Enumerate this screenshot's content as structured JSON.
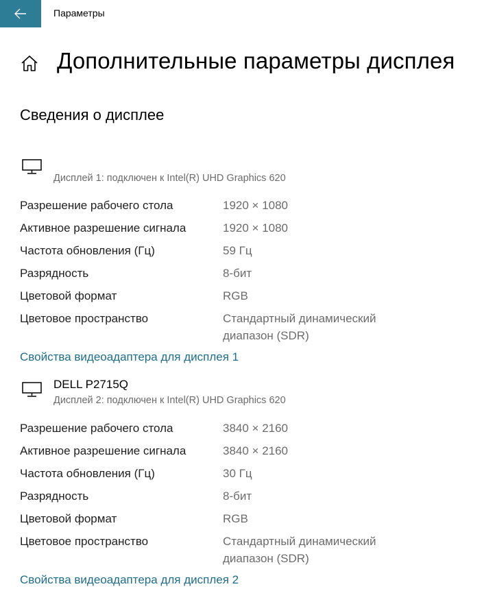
{
  "window": {
    "title": "Параметры"
  },
  "page": {
    "title": "Дополнительные параметры дисплея",
    "section_title": "Сведения о дисплее"
  },
  "colors": {
    "accent": "#2e7d96",
    "link": "#1d6d8c",
    "secondary_text": "#6b6b6b"
  },
  "icons": {
    "back": "arrow-left-icon",
    "home": "home-icon",
    "monitor": "monitor-icon"
  },
  "displays": [
    {
      "name": "",
      "subtitle": "Дисплей 1: подключен к Intel(R) UHD Graphics 620",
      "rows": [
        {
          "label": "Разрешение рабочего стола",
          "value": "1920 × 1080"
        },
        {
          "label": "Активное разрешение сигнала",
          "value": "1920 × 1080"
        },
        {
          "label": "Частота обновления (Гц)",
          "value": "59 Гц"
        },
        {
          "label": "Разрядность",
          "value": "8-бит"
        },
        {
          "label": "Цветовой формат",
          "value": "RGB"
        },
        {
          "label": "Цветовое пространство",
          "value": "Стандартный динамический диапазон (SDR)"
        }
      ],
      "adapter_link": "Свойства видеоадаптера для дисплея 1"
    },
    {
      "name": "DELL P2715Q",
      "subtitle": "Дисплей 2: подключен к Intel(R) UHD Graphics 620",
      "rows": [
        {
          "label": "Разрешение рабочего стола",
          "value": "3840 × 2160"
        },
        {
          "label": "Активное разрешение сигнала",
          "value": "3840 × 2160"
        },
        {
          "label": "Частота обновления (Гц)",
          "value": "30 Гц"
        },
        {
          "label": "Разрядность",
          "value": "8-бит"
        },
        {
          "label": "Цветовой формат",
          "value": "RGB"
        },
        {
          "label": "Цветовое пространство",
          "value": "Стандартный динамический диапазон (SDR)"
        }
      ],
      "adapter_link": "Свойства видеоадаптера для дисплея 2"
    }
  ]
}
